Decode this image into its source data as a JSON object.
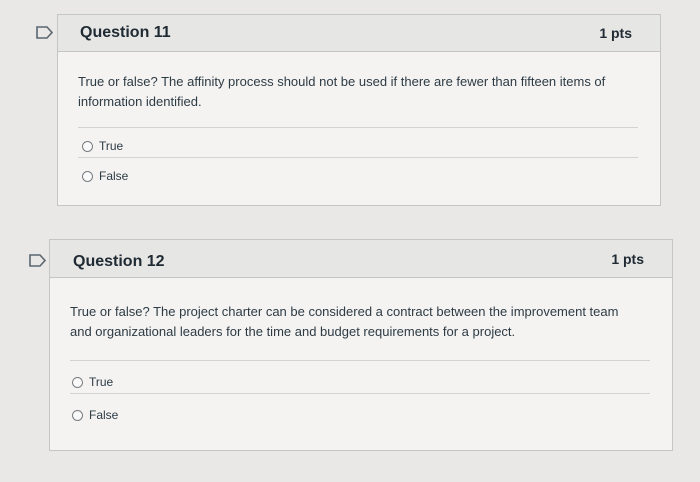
{
  "questions": [
    {
      "title": "Question 11",
      "points": "1 pts",
      "text_line1": "True or false? The affinity process should not be used if there are fewer than fifteen items of",
      "text_line2": "information identified.",
      "answers": [
        "True",
        "False"
      ]
    },
    {
      "title": "Question 12",
      "points": "1 pts",
      "text_line1": "True or false? The project charter can be considered a contract between the improvement team",
      "text_line2": "and organizational leaders for the time and budget requirements for a project.",
      "answers": [
        "True",
        "False"
      ]
    }
  ],
  "colors": {
    "background": "#e9e8e6",
    "card": "#f4f3f1",
    "header": "#e6e6e5",
    "border": "#c4c5c6",
    "flag": "#5b6670"
  },
  "icons": [
    "flag-question-icon",
    "radio-button-icon"
  ]
}
